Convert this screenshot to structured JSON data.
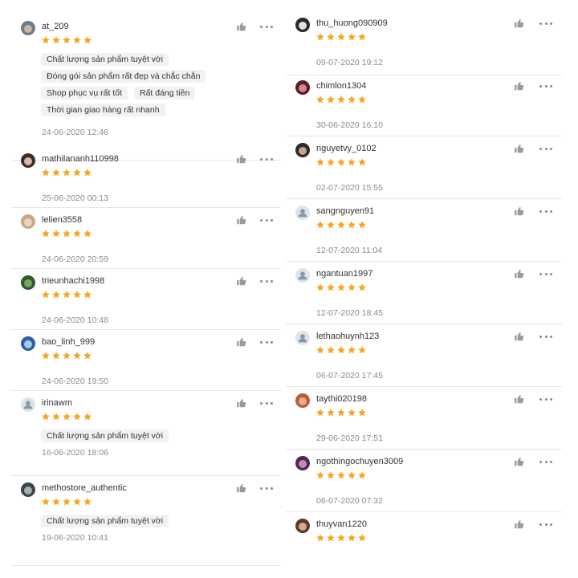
{
  "colors": {
    "star": "#f5a623",
    "muted": "#8a8a8a",
    "tag_bg": "#f2f2f2",
    "divider": "#e8e8e8"
  },
  "icons": {
    "like": "thumbs-up-icon",
    "more": "more-dots-icon",
    "star": "star-icon",
    "avatar_default": "user-icon"
  },
  "left_reviews": [
    {
      "username": "at_209",
      "stars": 5,
      "tags": [
        "Chất lượng sản phẩm tuyệt vời",
        "Đóng gói sản phẩm rất đẹp và chắc chắn",
        "Shop phục vụ rất tốt",
        "Rất đáng tiền",
        "Thời gian giao hàng rất nhanh"
      ],
      "date": "24-06-2020 12:46"
    },
    {
      "username": "mathilananh110998",
      "stars": 5,
      "tags": [],
      "date": "25-06-2020 00:13"
    },
    {
      "username": "lelien3558",
      "stars": 5,
      "tags": [],
      "date": "24-06-2020 20:59"
    },
    {
      "username": "trieunhachi1998",
      "stars": 5,
      "tags": [],
      "date": "24-06-2020 10:48"
    },
    {
      "username": "bao_linh_999",
      "stars": 5,
      "tags": [],
      "date": "24-06-2020 19:50"
    },
    {
      "username": "irinawm",
      "stars": 5,
      "tags": [
        "Chất lượng sản phẩm tuyệt vời"
      ],
      "date": "16-06-2020 18:06"
    },
    {
      "username": "methostore_authentic",
      "stars": 5,
      "tags": [
        "Chất lượng sản phẩm tuyệt vời"
      ],
      "date": "19-06-2020 10:41"
    }
  ],
  "right_reviews": [
    {
      "username": "thu_huong090909",
      "stars": 5,
      "date": "09-07-2020 19:12"
    },
    {
      "username": "chimlon1304",
      "stars": 5,
      "date": "30-06-2020 16:10"
    },
    {
      "username": "nguyetvy_0102",
      "stars": 5,
      "date": "02-07-2020 15:55"
    },
    {
      "username": "sangnguyen91",
      "stars": 5,
      "date": "12-07-2020 11:04"
    },
    {
      "username": "ngantuan1997",
      "stars": 5,
      "date": "12-07-2020 18:45"
    },
    {
      "username": "lethaohuynh123",
      "stars": 5,
      "date": "06-07-2020 17:45"
    },
    {
      "username": "taythi020198",
      "stars": 5,
      "date": "29-06-2020 17:51"
    },
    {
      "username": "ngothingochuyen3009",
      "stars": 5,
      "date": "06-07-2020 07:32"
    },
    {
      "username": "thuyvan1220",
      "stars": 5,
      "date": ""
    }
  ]
}
